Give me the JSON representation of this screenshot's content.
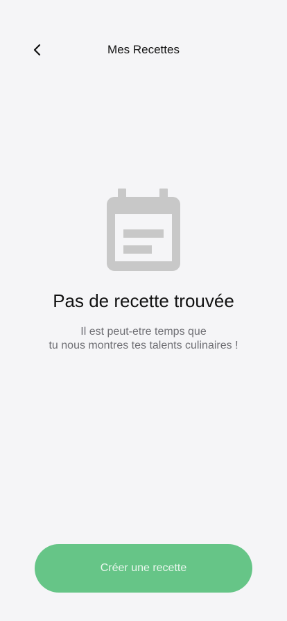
{
  "header": {
    "title": "Mes Recettes",
    "back_icon": "chevron-left-icon"
  },
  "empty_state": {
    "icon": "calendar-list-icon",
    "title": "Pas de recette trouvée",
    "description_line1": "Il est peut-etre temps que",
    "description_line2": "tu nous montres tes talents culinaires !"
  },
  "actions": {
    "create_label": "Créer une recette"
  },
  "colors": {
    "background": "#f5f5f7",
    "accent": "#66c587",
    "icon_gray": "#c8c8c8",
    "text_secondary": "#6f6f74"
  }
}
